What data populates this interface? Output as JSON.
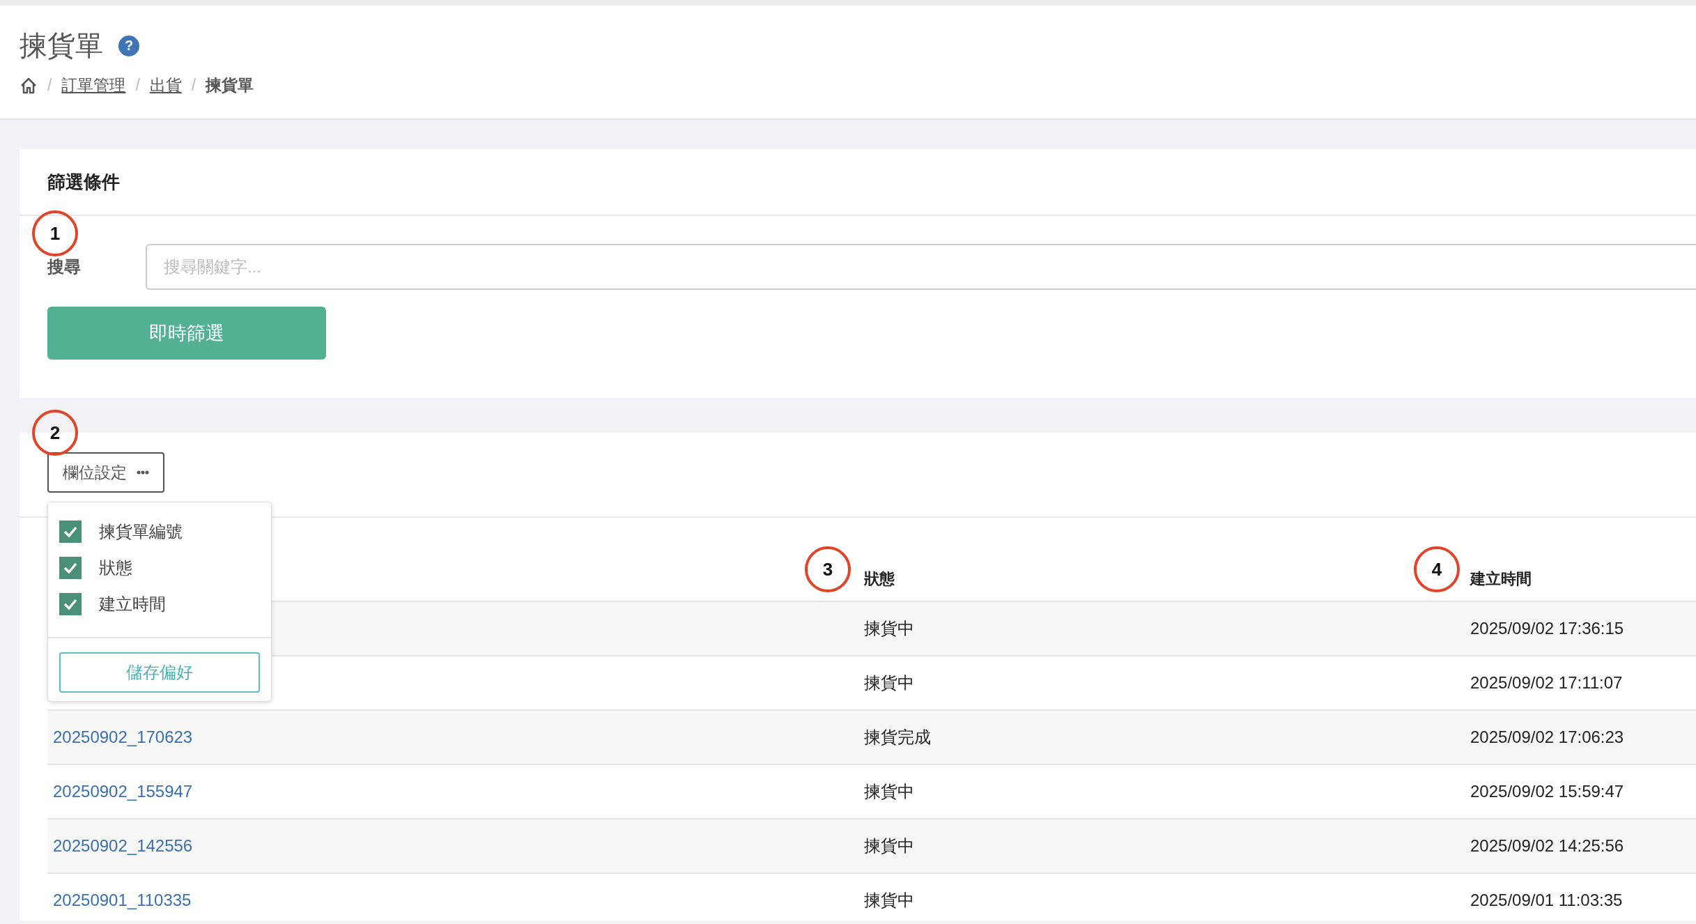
{
  "page": {
    "title": "揀貨單",
    "help": "?",
    "breadcrumb": [
      {
        "separator": "/",
        "label": "訂單管理",
        "link": true
      },
      {
        "separator": "/",
        "label": "出貨",
        "link": true
      },
      {
        "separator": "/",
        "label": "揀貨單",
        "link": false
      }
    ]
  },
  "filter": {
    "title": "篩選條件",
    "search_label": "搜尋",
    "search": {
      "placeholder": "搜尋關鍵字..."
    },
    "apply_button": "即時篩選"
  },
  "column_settings": {
    "button": "欄位設定",
    "options": [
      {
        "label": "揀貨單編號",
        "checked": true
      },
      {
        "label": "狀態",
        "checked": true
      },
      {
        "label": "建立時間",
        "checked": true
      }
    ],
    "save_button": "儲存偏好"
  },
  "table": {
    "columns": {
      "status": "狀態",
      "created": "建立時間"
    },
    "rows": [
      {
        "status": "揀貨中",
        "created": "2025/09/02 17:36:15"
      },
      {
        "status": "揀貨中",
        "created": "2025/09/02 17:11:07"
      },
      {
        "id": "20250902_170623",
        "status": "揀貨完成",
        "created": "2025/09/02 17:06:23"
      },
      {
        "id": "20250902_155947",
        "status": "揀貨中",
        "created": "2025/09/02 15:59:47"
      },
      {
        "id": "20250902_142556",
        "status": "揀貨中",
        "created": "2025/09/02 14:25:56"
      },
      {
        "id": "20250901_110335",
        "status": "揀貨中",
        "created": "2025/09/01 11:03:35"
      }
    ]
  },
  "annotations": [
    "1",
    "2",
    "3",
    "4"
  ]
}
